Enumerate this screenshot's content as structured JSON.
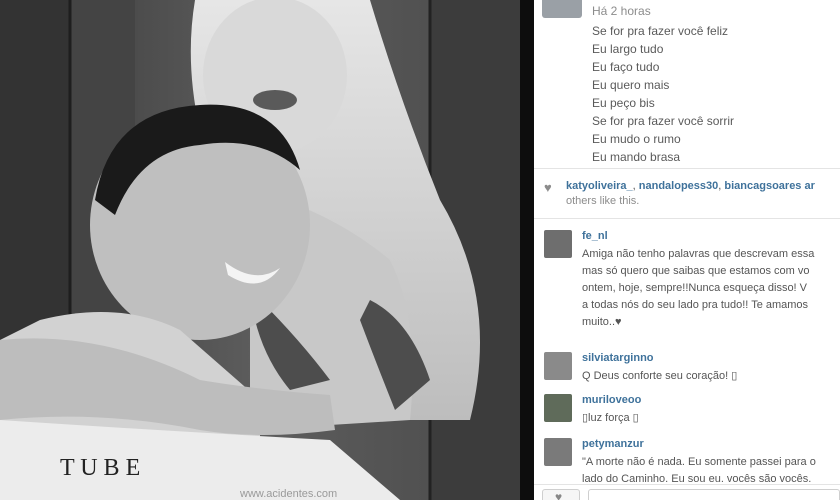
{
  "caption": {
    "time": "Há 2 horas",
    "lines": [
      "Se for pra fazer você feliz",
      "Eu largo tudo",
      "Eu faço tudo",
      "Eu quero mais",
      "Eu peço bis",
      "Se for pra fazer você sorrir",
      "Eu mudo o rumo",
      "Eu mando brasa"
    ]
  },
  "likes": {
    "user1": "katyoliveira_",
    "user2": "nandalopess30",
    "user3": "biancagsoares",
    "tail_partial": "ar",
    "tail": "others like this."
  },
  "comments": [
    {
      "user": "fe_nl",
      "lines": [
        "Amiga não tenho palavras que descrevam essa",
        "mas só quero que saibas que estamos com vo",
        "ontem, hoje, sempre!!Nunca esqueça disso! V",
        "a todas nós do seu lado pra tudo!! Te amamos",
        "muito..♥"
      ]
    },
    {
      "user": "silviatarginno",
      "lines": [
        "Q Deus conforte seu coração! ▯"
      ]
    },
    {
      "user": "muriloveoo",
      "lines": [
        "▯luz força ▯"
      ]
    },
    {
      "user": "petymanzur",
      "lines": [
        "\"A morte não é nada. Eu somente passei para o",
        "lado do Caminho. Eu sou eu. vocês são vocês."
      ]
    }
  ],
  "photo": {
    "shirt_text": "T U B E",
    "watermark": "www.acidentes.com"
  },
  "icons": {
    "heart": "heart-icon"
  }
}
